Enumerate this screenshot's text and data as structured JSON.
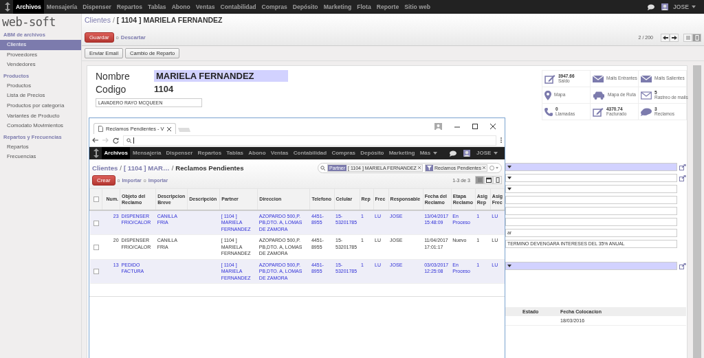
{
  "top_nav": {
    "menus": [
      {
        "label": "Archivos",
        "selected": true
      },
      {
        "label": "Mensajería",
        "selected": false
      },
      {
        "label": "Dispenser",
        "selected": false
      },
      {
        "label": "Repartos",
        "selected": false
      },
      {
        "label": "Tablas",
        "selected": false
      },
      {
        "label": "Abono",
        "selected": false
      },
      {
        "label": "Ventas",
        "selected": false
      },
      {
        "label": "Contabilidad",
        "selected": false
      },
      {
        "label": "Compras",
        "selected": false
      },
      {
        "label": "Depósito",
        "selected": false
      },
      {
        "label": "Marketing",
        "selected": false
      },
      {
        "label": "Flota",
        "selected": false
      },
      {
        "label": "Reporte",
        "selected": false
      },
      {
        "label": "Sitio web",
        "selected": false
      }
    ],
    "user": "JOSE"
  },
  "sidebar": {
    "logo": "web-soft",
    "sections": [
      {
        "title": "ABM de archivos",
        "items": [
          {
            "label": "Clientes",
            "selected": true
          },
          {
            "label": "Proveedores",
            "selected": false
          },
          {
            "label": "Vendedores",
            "selected": false
          }
        ]
      },
      {
        "title": "Productos",
        "items": [
          {
            "label": "Productos",
            "selected": false
          },
          {
            "label": "Lista de Precios",
            "selected": false
          },
          {
            "label": "Productos por categoría",
            "selected": false
          },
          {
            "label": "Variantes de Producto",
            "selected": false
          },
          {
            "label": "Comodato Movimientos",
            "selected": false
          }
        ]
      },
      {
        "title": "Repartos y Frecuencias",
        "items": [
          {
            "label": "Repartos",
            "selected": false
          },
          {
            "label": "Frecuencias",
            "selected": false
          }
        ]
      }
    ]
  },
  "breadcrumb": {
    "parent": "Clientes",
    "separator": "/",
    "current": "[ 1104 ] MARIELA FERNANDEZ"
  },
  "actions": {
    "save": "Guardar",
    "or": "o",
    "discard": "Descartar"
  },
  "pager": "2 / 200",
  "views": [
    {
      "kind": "list",
      "selected": false
    },
    {
      "kind": "form",
      "selected": true
    }
  ],
  "buttons": [
    "Enviar Email",
    "Cambio de Reparto"
  ],
  "form": {
    "name_label": "Nombre",
    "name": "MARIELA FERNANDEZ",
    "code_label": "Codigo",
    "code": "1104",
    "business": "LAVADERO RAYO MCQUEEN"
  },
  "smart_buttons": [
    {
      "kind": "pencil",
      "value": "3947.66",
      "label": "Saldo"
    },
    {
      "kind": "envelope",
      "label": "Mails Entrantes"
    },
    {
      "kind": "envelope",
      "label": "Mails Salientes"
    },
    {
      "kind": "pin",
      "label": "Mapa"
    },
    {
      "kind": "car",
      "label": "Mapa de Ruta"
    },
    {
      "kind": "letter",
      "value": "5",
      "label": "Rastreo de mails"
    },
    {
      "kind": "phone",
      "value": "0",
      "label": "Llamadas"
    },
    {
      "kind": "pencil",
      "value": "4370.74",
      "label": "Facturado"
    },
    {
      "kind": "chat",
      "value": "3",
      "label": "Reclamos"
    }
  ],
  "fields": [
    {
      "kind": "select",
      "required": true,
      "link": true
    },
    {
      "kind": "select",
      "required": false,
      "link": true
    },
    {
      "kind": "select",
      "required": false,
      "link": false
    },
    {
      "kind": "text",
      "required": false,
      "link": false
    },
    {
      "kind": "text",
      "required": false,
      "link": false
    },
    {
      "kind": "text",
      "required": false,
      "link": false
    },
    {
      "kind": "text",
      "value": "ar",
      "required": false,
      "link": false
    },
    {
      "kind": "text",
      "value": "TERMINO DEVENGARA INTERESES DEL 35% ANUAL",
      "required": false,
      "link": false
    },
    {
      "kind": "blank"
    },
    {
      "kind": "select",
      "required": true,
      "link": true
    }
  ],
  "lower_table": {
    "columns": [
      "Estado",
      "Fecha Colocacion"
    ],
    "rows": [
      [
        "",
        "18/03/2016"
      ]
    ]
  },
  "popup": {
    "tab_title": "Reclamos Pendientes - V",
    "top_nav": {
      "menus": [
        {
          "label": "Archivos",
          "selected": true
        },
        {
          "label": "Mensajería",
          "selected": false
        },
        {
          "label": "Dispenser",
          "selected": false
        },
        {
          "label": "Repartos",
          "selected": false
        },
        {
          "label": "Tablas",
          "selected": false
        },
        {
          "label": "Abono",
          "selected": false
        },
        {
          "label": "Ventas",
          "selected": false
        },
        {
          "label": "Contabilidad",
          "selected": false
        },
        {
          "label": "Compras",
          "selected": false
        },
        {
          "label": "Depósito",
          "selected": false
        },
        {
          "label": "Marketing",
          "selected": false
        }
      ],
      "more": "Más",
      "user": "JOSE"
    },
    "breadcrumb": [
      "Clientes",
      "[ 1104 ] MAR…",
      "Reclamos Pendientes"
    ],
    "breadcrumb_separators": [
      "/",
      "/"
    ],
    "search_facets": [
      {
        "kind": "field",
        "label": "Partner",
        "value": "[ 1104 ] MARIELA FERNANDEZ"
      },
      {
        "kind": "filter",
        "value": "Reclamos Pendientes"
      }
    ],
    "create": "Crear",
    "links": [
      "o",
      "Importar",
      "o",
      "Importar"
    ],
    "pager": "1-3 de 3",
    "views": [
      {
        "kind": "list",
        "selected": true
      },
      {
        "kind": "calendar",
        "selected": false
      },
      {
        "kind": "form",
        "selected": false
      }
    ],
    "table": {
      "checked": false,
      "columns": [
        "Num.",
        "Objeto del Reclamo",
        "Descripcion Breve",
        "Descripción",
        "Partner",
        "Direccion",
        "Telefono",
        "Celular",
        "Rep",
        "Frec",
        "Responsable",
        "Fecha del Reclamo",
        "Etapa Reclamo",
        "Asig Rep",
        "Asig Frec"
      ],
      "rows": [
        {
          "checked": false,
          "highlighted": true,
          "cells": [
            "23",
            "DISPENSER FRIO/CALOR",
            "CANILLA FRIA",
            "",
            "[ 1104 ] MARIELA FERNANDEZ",
            "AZOPARDO 500,P. PB,DTO. A, LOMAS DE ZAMORA",
            "4451-8955",
            "15-53201785",
            "1",
            "LU",
            "JOSE",
            "13/04/2017 15:48:09",
            "En Proceso",
            "1",
            "LU"
          ]
        },
        {
          "checked": false,
          "highlighted": false,
          "cells": [
            "20",
            "DISPENSER FRIO/CALOR",
            "CANILLA FRIA",
            "",
            "[ 1104 ] MARIELA FERNANDEZ",
            "AZOPARDO 500,P. PB,DTO. A, LOMAS DE ZAMORA",
            "4451-8955",
            "15-53201785",
            "1",
            "LU",
            "JOSE",
            "11/04/2017 17:01:17",
            "Nuevo",
            "1",
            "LU"
          ]
        },
        {
          "checked": false,
          "highlighted": true,
          "cells": [
            "13",
            "PEDIDO FACTURA",
            "",
            "",
            "[ 1104 ] MARIELA FERNANDEZ",
            "AZOPARDO 500,P. PB,DTO. A, LOMAS DE ZAMORA",
            "4451-8955",
            "15-53201785",
            "1",
            "LU",
            "JOSE",
            "03/03/2017 12:25:08",
            "En Proceso",
            "1",
            "LU"
          ]
        }
      ]
    }
  }
}
